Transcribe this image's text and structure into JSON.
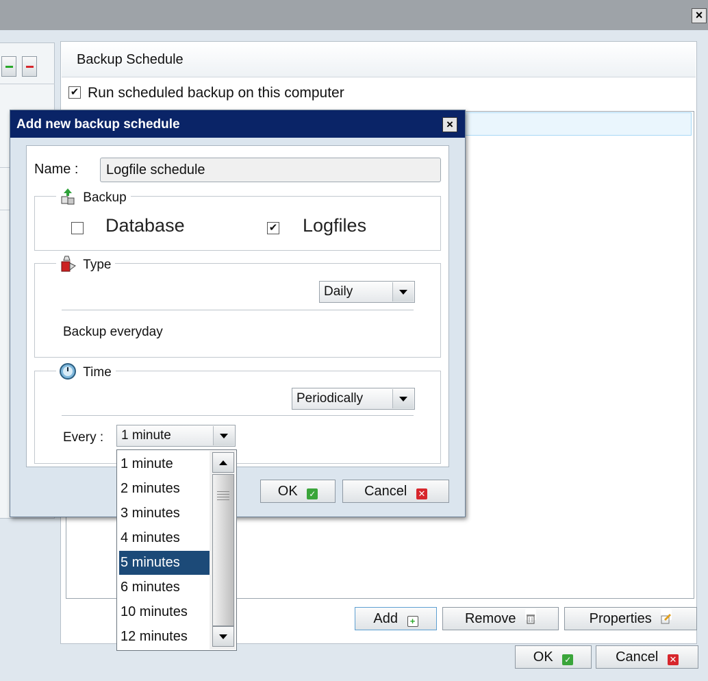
{
  "window": {
    "close_glyph": "×"
  },
  "schedule_panel": {
    "title": "Backup Schedule",
    "run_scheduled_label": "Run scheduled backup on this computer",
    "run_scheduled_checked": true,
    "buttons": {
      "add": "Add",
      "remove": "Remove",
      "properties": "Properties"
    }
  },
  "main_buttons": {
    "ok": "OK",
    "cancel": "Cancel"
  },
  "dialog": {
    "title": "Add new backup schedule",
    "close_glyph": "×",
    "name_label": "Name :",
    "name_value": "Logfile schedule",
    "backup_group": {
      "legend": "Backup",
      "database_label": "Database",
      "database_checked": false,
      "logfiles_label": "Logfiles",
      "logfiles_checked": true
    },
    "type_group": {
      "legend": "Type",
      "selected": "Daily",
      "description": "Backup everyday"
    },
    "time_group": {
      "legend": "Time",
      "selected": "Periodically",
      "every_label": "Every :",
      "every_selected": "1 minute"
    },
    "ok": "OK",
    "cancel": "Cancel"
  },
  "dropdown": {
    "items": [
      "1 minute",
      "2 minutes",
      "3 minutes",
      "4 minutes",
      "5 minutes",
      "6 minutes",
      "10 minutes",
      "12 minutes"
    ],
    "highlighted": "5 minutes"
  },
  "colors": {
    "dialog_title_bg": "#0a2467",
    "highlight": "#1c4a78",
    "ok_icon": "#3aa53a",
    "cancel_icon": "#d7262c",
    "add_icon": "#28a828"
  },
  "icons": {
    "add": "plus-icon",
    "remove": "minus-icon",
    "add_schedule": "add-square-icon",
    "trash": "trash-icon",
    "edit": "edit-icon",
    "ok": "check-icon",
    "cancel": "x-icon",
    "backup": "backup-cubes-icon",
    "type": "type-cubes-icon",
    "time": "clock-icon"
  }
}
